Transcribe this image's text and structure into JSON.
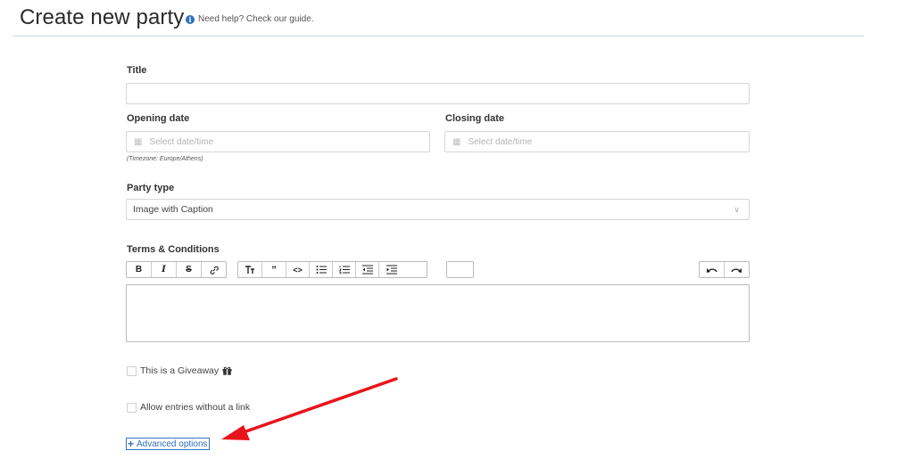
{
  "header": {
    "title": "Create new party",
    "help_text": "Need help? Check our guide."
  },
  "form": {
    "title_label": "Title",
    "title_value": "",
    "opening_date_label": "Opening date",
    "opening_date_placeholder": "Select date/time",
    "closing_date_label": "Closing date",
    "closing_date_placeholder": "Select date/time",
    "timezone_note": "(Timezone: Europe/Athens)",
    "party_type_label": "Party type",
    "party_type_value": "Image with Caption",
    "terms_label": "Terms & Conditions",
    "giveaway_label": "This is a Giveaway",
    "giveaway_checked": false,
    "allow_entries_label": "Allow entries without a link",
    "allow_entries_checked": false,
    "advanced_options_label": "Advanced options"
  },
  "toolbar": {
    "bold": "B",
    "italic": "I",
    "strikethrough": "S",
    "link": "link",
    "heading": "heading",
    "quote": "quote",
    "code": "code",
    "bullet_list": "bullet-list",
    "ordered_list": "ordered-list",
    "outdent": "outdent",
    "indent": "indent",
    "undo": "undo",
    "redo": "redo"
  },
  "colors": {
    "accent": "#2f6ebd",
    "annotation_arrow": "#e8141b"
  }
}
